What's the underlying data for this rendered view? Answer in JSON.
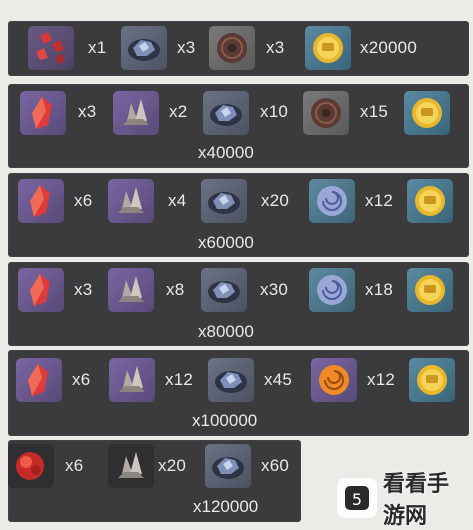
{
  "rows": [
    {
      "items": [
        {
          "icon": "red-ore-fragments-icon",
          "qty": "x1"
        },
        {
          "icon": "blue-ore-icon",
          "qty": "x3"
        },
        {
          "icon": "brown-disc-icon",
          "qty": "x3"
        },
        {
          "icon": "gold-coin-icon",
          "qty": "x20000"
        }
      ],
      "total": ""
    },
    {
      "items": [
        {
          "icon": "red-crystal-icon",
          "qty": "x3"
        },
        {
          "icon": "grey-crystal-cluster-icon",
          "qty": "x2"
        },
        {
          "icon": "blue-ore-icon",
          "qty": "x10"
        },
        {
          "icon": "brown-disc-icon",
          "qty": "x15"
        },
        {
          "icon": "gold-coin-icon",
          "qty": ""
        }
      ],
      "total": "x40000"
    },
    {
      "items": [
        {
          "icon": "red-crystal-icon",
          "qty": "x6"
        },
        {
          "icon": "grey-crystal-cluster-icon",
          "qty": "x4"
        },
        {
          "icon": "blue-ore-icon",
          "qty": "x20"
        },
        {
          "icon": "blue-swirl-disc-icon",
          "qty": "x12"
        },
        {
          "icon": "gold-coin-icon",
          "qty": ""
        }
      ],
      "total": "x60000"
    },
    {
      "items": [
        {
          "icon": "red-crystal-icon",
          "qty": "x3"
        },
        {
          "icon": "grey-crystal-cluster-icon",
          "qty": "x8"
        },
        {
          "icon": "blue-ore-icon",
          "qty": "x30"
        },
        {
          "icon": "blue-swirl-disc-icon",
          "qty": "x18"
        },
        {
          "icon": "gold-coin-icon",
          "qty": ""
        }
      ],
      "total": "x80000"
    },
    {
      "items": [
        {
          "icon": "red-crystal-icon",
          "qty": "x6"
        },
        {
          "icon": "grey-crystal-cluster-icon",
          "qty": "x12"
        },
        {
          "icon": "blue-ore-icon",
          "qty": "x45"
        },
        {
          "icon": "orange-swirl-disc-icon",
          "qty": "x12"
        },
        {
          "icon": "gold-coin-icon",
          "qty": ""
        }
      ],
      "total": "x100000"
    },
    {
      "items": [
        {
          "icon": "red-gem-cluster-icon",
          "qty": "x6"
        },
        {
          "icon": "grey-crystal-cluster-icon",
          "qty": "x20"
        },
        {
          "icon": "blue-ore-icon",
          "qty": "x60"
        }
      ],
      "total": "x120000"
    }
  ],
  "watermark": {
    "text": "看看手游网",
    "icon": "watermark-logo-icon"
  }
}
